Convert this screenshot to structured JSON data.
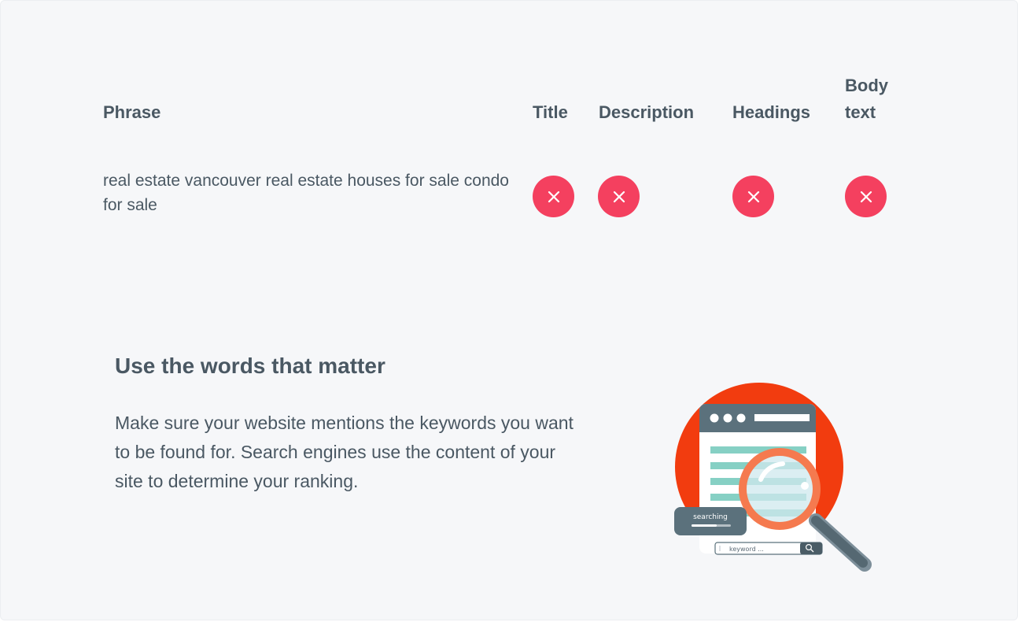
{
  "table": {
    "headers": {
      "phrase": "Phrase",
      "title": "Title",
      "description": "Description",
      "headings": "Headings",
      "body_line1": "Body",
      "body_line2": "text"
    },
    "row": {
      "phrase": "real estate vancouver real estate houses for sale condo for sale",
      "title": "missing",
      "description": "missing",
      "headings": "missing",
      "body": "missing"
    },
    "status_icon": "x-icon",
    "status_color": "#f4405f"
  },
  "section": {
    "heading": "Use the words that matter",
    "body": "Make sure your website mentions the keywords you want to be found for. Search engines use the content of your site to determine your ranking."
  },
  "illustration": {
    "searching_label": "searching",
    "keyword_placeholder": "keyword ...",
    "icon": "magnifier-icon",
    "circle_color": "#f23c0f"
  }
}
